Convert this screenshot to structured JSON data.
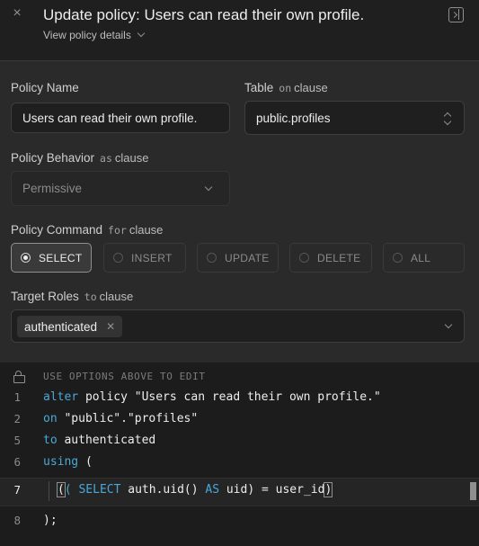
{
  "header": {
    "title": "Update policy: Users can read their own profile.",
    "subtitle": "View policy details"
  },
  "form": {
    "policy_name_label": "Policy Name",
    "policy_name_value": "Users can read their own profile.",
    "table_label": "Table",
    "table_clause_kw": "on",
    "table_clause_word": "clause",
    "table_value": "public.profiles",
    "behavior_label": "Policy Behavior",
    "behavior_clause_kw": "as",
    "behavior_clause_word": "clause",
    "behavior_value": "Permissive",
    "command_label": "Policy Command",
    "command_clause_kw": "for",
    "command_clause_word": "clause",
    "commands": [
      "SELECT",
      "INSERT",
      "UPDATE",
      "DELETE",
      "ALL"
    ],
    "selected_command": "SELECT",
    "roles_label": "Target Roles",
    "roles_clause_kw": "to",
    "roles_clause_word": "clause",
    "roles": [
      "authenticated"
    ]
  },
  "editor": {
    "hint": "USE OPTIONS ABOVE TO EDIT",
    "line_numbers": [
      "1",
      "2",
      "5",
      "6",
      "7",
      "8"
    ],
    "l1_kw": "alter",
    "l1_rest": " policy \"Users can read their own profile.\"",
    "l2_kw": "on",
    "l2_rest": " \"public\".\"profiles\"",
    "l5_kw": "to",
    "l5_rest": " authenticated",
    "l6_kw": "using",
    "l6_rest": " (",
    "l7_open": "(",
    "l7_p2": "( ",
    "l7_select": "SELECT",
    "l7_mid": " auth.uid() ",
    "l7_as": "AS",
    "l7_rest": " uid) = user_id",
    "l7_close": ")",
    "l8": ");"
  },
  "colors": {
    "keyword": "#4aa8d8",
    "background": "#2a2a2a",
    "header_bg": "#1f1f1f"
  }
}
